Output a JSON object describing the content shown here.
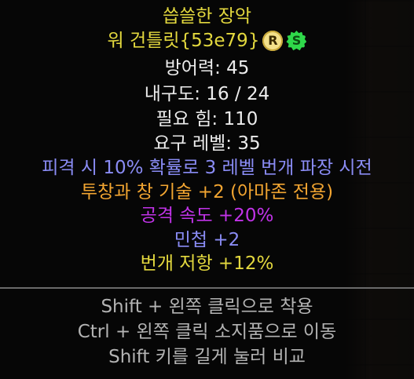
{
  "item": {
    "name": "씁쓸한 장악",
    "base_name": "워 건틀릿{53e79}",
    "badges": {
      "rare_letter": "R",
      "set_letter": "S"
    },
    "defense": "방어력: 45",
    "durability": "내구도: 16 / 24",
    "required_strength": "필요 힘: 110",
    "required_level": "요구 레벨: 35",
    "magic_properties": [
      "피격 시 10% 확률로 3 레벨 번개 파장 시전",
      "투창과 창 기술 +2 (아마존 전용)",
      "공격 속도 +20%",
      "민첩 +2",
      "번개 저항 +12%"
    ]
  },
  "instructions": [
    "Shift + 왼쪽 클릭으로 착용",
    "Ctrl + 왼쪽 클릭 소지품으로 이동",
    "Shift 키를 길게 눌러 비교"
  ],
  "colors": {
    "unique_gold": "#e3d83e",
    "stat_white": "#ececec",
    "proc_blue": "#8a8cf5",
    "skill_orange": "#f2a531",
    "speed_purple": "#c133e8",
    "hint_grey": "#b3b3b3"
  }
}
